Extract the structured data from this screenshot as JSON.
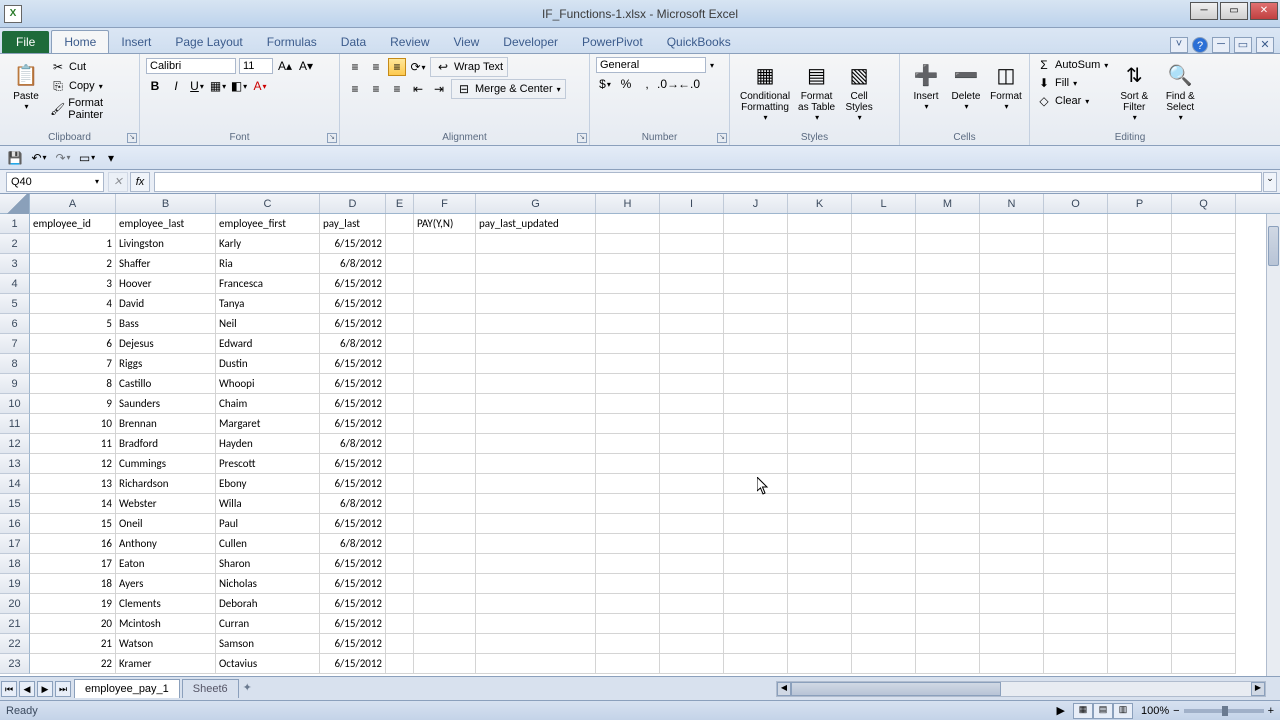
{
  "window": {
    "title": "IF_Functions-1.xlsx - Microsoft Excel",
    "logo_text": "X"
  },
  "tabs": {
    "file": "File",
    "list": [
      "Home",
      "Insert",
      "Page Layout",
      "Formulas",
      "Data",
      "Review",
      "View",
      "Developer",
      "PowerPivot",
      "QuickBooks"
    ],
    "active": "Home"
  },
  "ribbon": {
    "clipboard": {
      "paste": "Paste",
      "cut": "Cut",
      "copy": "Copy",
      "format_painter": "Format Painter",
      "label": "Clipboard"
    },
    "font": {
      "name": "Calibri",
      "size": "11",
      "label": "Font"
    },
    "alignment": {
      "wrap": "Wrap Text",
      "merge": "Merge & Center",
      "label": "Alignment"
    },
    "number": {
      "format": "General",
      "label": "Number"
    },
    "styles": {
      "cond": "Conditional\nFormatting",
      "table": "Format\nas Table",
      "cell": "Cell\nStyles",
      "label": "Styles"
    },
    "cells": {
      "insert": "Insert",
      "delete": "Delete",
      "format": "Format",
      "label": "Cells"
    },
    "editing": {
      "autosum": "AutoSum",
      "fill": "Fill",
      "clear": "Clear",
      "sort": "Sort &\nFilter",
      "find": "Find &\nSelect",
      "label": "Editing"
    }
  },
  "namebox": "Q40",
  "formula": "",
  "columns": [
    {
      "l": "A",
      "w": 86
    },
    {
      "l": "B",
      "w": 100
    },
    {
      "l": "C",
      "w": 104
    },
    {
      "l": "D",
      "w": 66
    },
    {
      "l": "E",
      "w": 28
    },
    {
      "l": "F",
      "w": 62
    },
    {
      "l": "G",
      "w": 120
    },
    {
      "l": "H",
      "w": 64
    },
    {
      "l": "I",
      "w": 64
    },
    {
      "l": "J",
      "w": 64
    },
    {
      "l": "K",
      "w": 64
    },
    {
      "l": "L",
      "w": 64
    },
    {
      "l": "M",
      "w": 64
    },
    {
      "l": "N",
      "w": 64
    },
    {
      "l": "O",
      "w": 64
    },
    {
      "l": "P",
      "w": 64
    },
    {
      "l": "Q",
      "w": 64
    }
  ],
  "chart_data": {
    "type": "table",
    "headers": [
      "employee_id",
      "employee_last",
      "employee_first",
      "pay_last",
      "",
      "PAY(Y,N)",
      "pay_last_updated"
    ],
    "rows": [
      [
        "1",
        "Livingston",
        "Karly",
        "6/15/2012",
        "",
        "",
        ""
      ],
      [
        "2",
        "Shaffer",
        "Ria",
        "6/8/2012",
        "",
        "",
        ""
      ],
      [
        "3",
        "Hoover",
        "Francesca",
        "6/15/2012",
        "",
        "",
        ""
      ],
      [
        "4",
        "David",
        "Tanya",
        "6/15/2012",
        "",
        "",
        ""
      ],
      [
        "5",
        "Bass",
        "Neil",
        "6/15/2012",
        "",
        "",
        ""
      ],
      [
        "6",
        "Dejesus",
        "Edward",
        "6/8/2012",
        "",
        "",
        ""
      ],
      [
        "7",
        "Riggs",
        "Dustin",
        "6/15/2012",
        "",
        "",
        ""
      ],
      [
        "8",
        "Castillo",
        "Whoopi",
        "6/15/2012",
        "",
        "",
        ""
      ],
      [
        "9",
        "Saunders",
        "Chaim",
        "6/15/2012",
        "",
        "",
        ""
      ],
      [
        "10",
        "Brennan",
        "Margaret",
        "6/15/2012",
        "",
        "",
        ""
      ],
      [
        "11",
        "Bradford",
        "Hayden",
        "6/8/2012",
        "",
        "",
        ""
      ],
      [
        "12",
        "Cummings",
        "Prescott",
        "6/15/2012",
        "",
        "",
        ""
      ],
      [
        "13",
        "Richardson",
        "Ebony",
        "6/15/2012",
        "",
        "",
        ""
      ],
      [
        "14",
        "Webster",
        "Willa",
        "6/8/2012",
        "",
        "",
        ""
      ],
      [
        "15",
        "Oneil",
        "Paul",
        "6/15/2012",
        "",
        "",
        ""
      ],
      [
        "16",
        "Anthony",
        "Cullen",
        "6/8/2012",
        "",
        "",
        ""
      ],
      [
        "17",
        "Eaton",
        "Sharon",
        "6/15/2012",
        "",
        "",
        ""
      ],
      [
        "18",
        "Ayers",
        "Nicholas",
        "6/15/2012",
        "",
        "",
        ""
      ],
      [
        "19",
        "Clements",
        "Deborah",
        "6/15/2012",
        "",
        "",
        ""
      ],
      [
        "20",
        "Mcintosh",
        "Curran",
        "6/15/2012",
        "",
        "",
        ""
      ],
      [
        "21",
        "Watson",
        "Samson",
        "6/15/2012",
        "",
        "",
        ""
      ],
      [
        "22",
        "Kramer",
        "Octavius",
        "6/15/2012",
        "",
        "",
        ""
      ]
    ]
  },
  "right_align_cols": [
    0,
    3
  ],
  "sheets": {
    "tabs": [
      "employee_pay_1",
      "Sheet6"
    ],
    "active": 0
  },
  "status": {
    "ready": "Ready",
    "zoom": "100%"
  }
}
